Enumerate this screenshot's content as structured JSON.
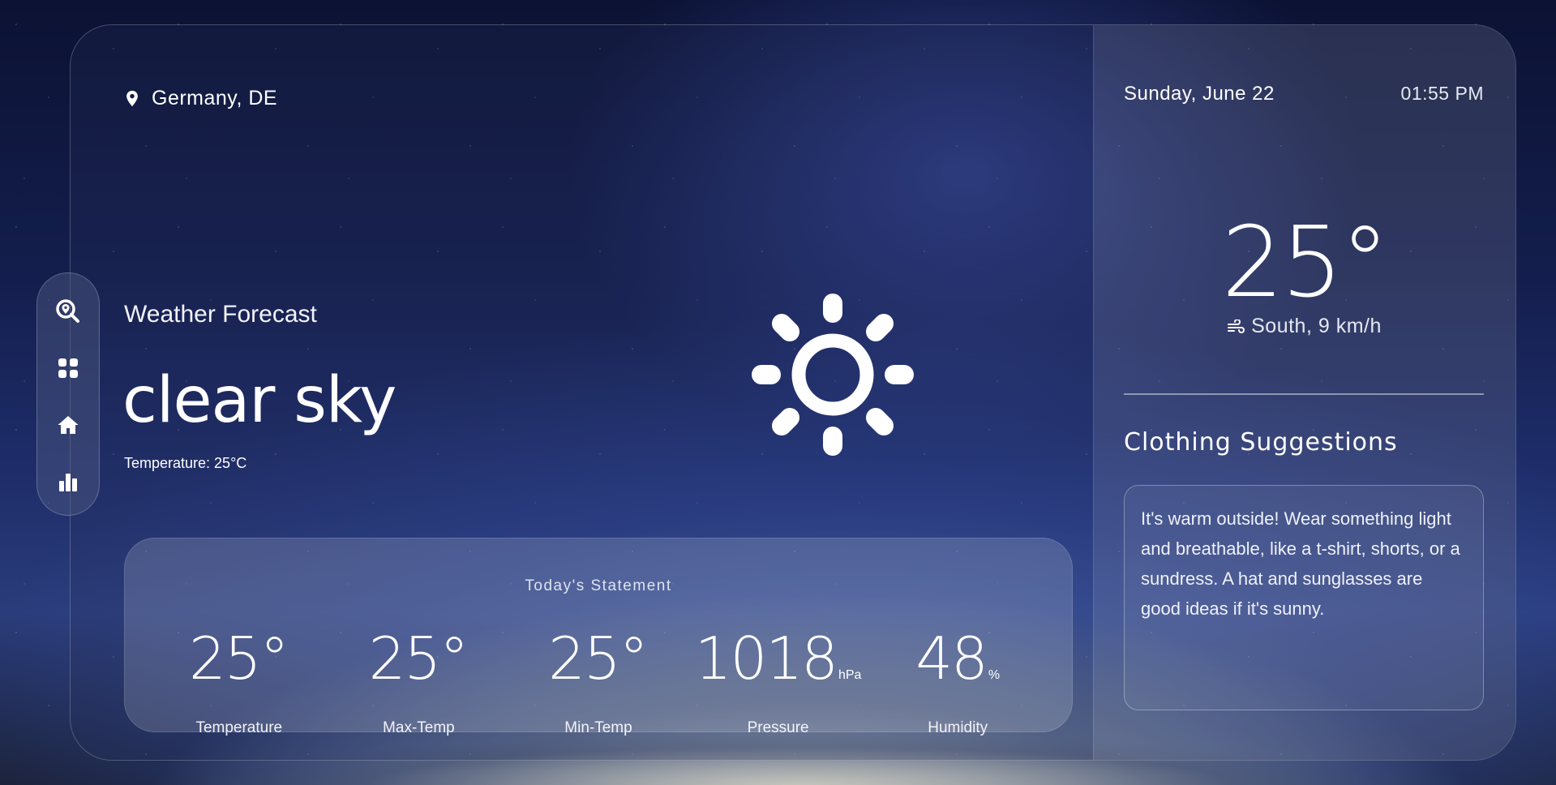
{
  "location": {
    "icon": "location-pin-icon",
    "label": "Germany, DE"
  },
  "forecast": {
    "heading": "Weather Forecast",
    "condition": "clear sky",
    "temperature_line": "Temperature: 25°C",
    "condition_icon": "sun-icon"
  },
  "statement": {
    "title": "Today's Statement",
    "stats": [
      {
        "value": "25°",
        "unit": "",
        "label": "Temperature"
      },
      {
        "value": "25°",
        "unit": "",
        "label": "Max-Temp"
      },
      {
        "value": "25°",
        "unit": "",
        "label": "Min-Temp"
      },
      {
        "value": "1018",
        "unit": "hPa",
        "label": "Pressure"
      },
      {
        "value": "48",
        "unit": "%",
        "label": "Humidity"
      }
    ]
  },
  "sidebar": {
    "items": [
      {
        "icon": "search-location-icon",
        "name": "search"
      },
      {
        "icon": "grid-icon",
        "name": "dashboard"
      },
      {
        "icon": "home-icon",
        "name": "home"
      },
      {
        "icon": "bar-chart-icon",
        "name": "stats"
      }
    ]
  },
  "right_panel": {
    "date": "Sunday, June 22",
    "time": "01:55 PM",
    "big_temp": "25°",
    "wind": "South, 9 km/h",
    "wind_icon": "wind-icon",
    "clothing_title": "Clothing Suggestions",
    "clothing_text": "It's warm outside! Wear something light and breathable, like a t-shirt, shorts, or a sundress. A hat and sunglasses are good ideas if it's sunny."
  },
  "colors": {
    "text": "#ffffff",
    "panel_glass": "rgba(255,255,255,0.10)",
    "background_top": "#0b1233",
    "background_glow": "#5d6d8f"
  }
}
